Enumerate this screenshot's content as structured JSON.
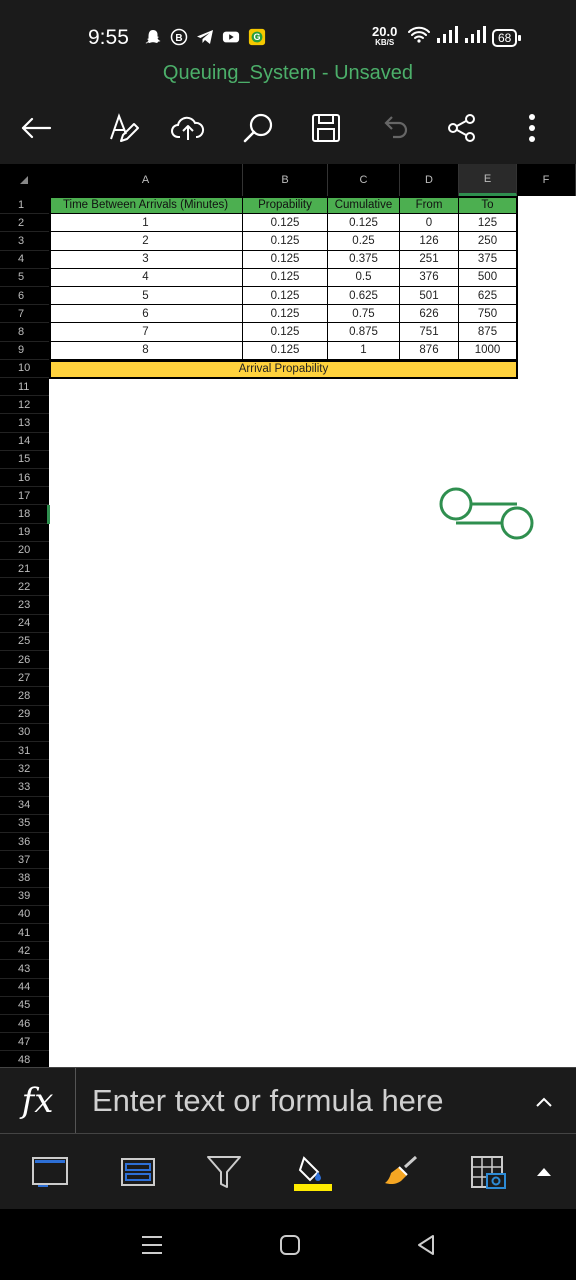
{
  "status_bar": {
    "time": "9:55",
    "net_speed": "20.0",
    "net_unit": "KB/S",
    "battery": "68",
    "icons": [
      "snapchat-icon",
      "b-badge-icon",
      "telegram-icon",
      "youtube-icon",
      "g-app-icon",
      "wifi-icon",
      "signal-icon",
      "signal-icon"
    ]
  },
  "document": {
    "title": "Queuing_System - Unsaved"
  },
  "toolbar": {
    "icons": [
      "back-arrow-icon",
      "text-format-icon",
      "cloud-upload-icon",
      "search-icon",
      "save-icon",
      "undo-icon",
      "share-icon",
      "more-vertical-icon"
    ]
  },
  "sheet": {
    "columns": [
      "A",
      "B",
      "C",
      "D",
      "E",
      "F"
    ],
    "rows": [
      "1",
      "2",
      "3",
      "4",
      "5",
      "6",
      "7",
      "8",
      "9",
      "10",
      "11",
      "12",
      "13",
      "14",
      "15",
      "16",
      "17",
      "18",
      "19",
      "20",
      "21",
      "22",
      "23",
      "24",
      "25",
      "26",
      "27",
      "28",
      "29",
      "30",
      "31",
      "32",
      "33",
      "34",
      "35",
      "36",
      "37",
      "38",
      "39",
      "40",
      "41",
      "42",
      "43",
      "44",
      "45",
      "46",
      "47",
      "48"
    ],
    "selected_row": "18",
    "selected_column": "E",
    "table": {
      "headers": [
        "Time Between Arrivals (Minutes)",
        "Propability",
        "Cumulative",
        "From",
        "To"
      ],
      "rows": [
        [
          "1",
          "0.125",
          "0.125",
          "0",
          "125"
        ],
        [
          "2",
          "0.125",
          "0.25",
          "126",
          "250"
        ],
        [
          "3",
          "0.125",
          "0.375",
          "251",
          "375"
        ],
        [
          "4",
          "0.125",
          "0.5",
          "376",
          "500"
        ],
        [
          "5",
          "0.125",
          "0.625",
          "501",
          "625"
        ],
        [
          "6",
          "0.125",
          "0.75",
          "626",
          "750"
        ],
        [
          "7",
          "0.125",
          "0.875",
          "751",
          "875"
        ],
        [
          "8",
          "0.125",
          "1",
          "876",
          "1000"
        ]
      ],
      "footer": "Arrival Propability"
    },
    "header_color": "#4caf50",
    "footer_color": "#ffd23d"
  },
  "formula_bar": {
    "fx_label": "fx",
    "placeholder": "Enter text or formula here"
  },
  "bottom_tools": {
    "icons": [
      "freeze-panes-icon",
      "sheet-layout-icon",
      "filter-icon",
      "fill-color-icon",
      "format-painter-icon",
      "insert-table-icon",
      "expand-up-icon"
    ],
    "fill_color": "#ffeb00"
  },
  "nav_bar": {
    "icons": [
      "recent-apps-icon",
      "home-icon",
      "back-icon"
    ]
  },
  "accent_color": "#2f8f4f"
}
